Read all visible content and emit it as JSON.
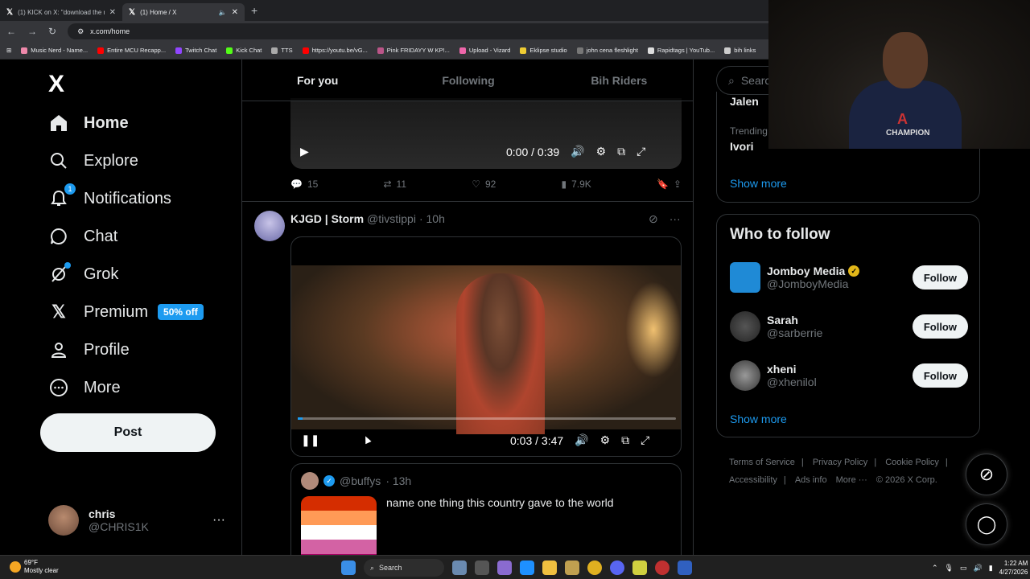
{
  "browser": {
    "tabs": [
      {
        "title": "(1) KICK on X: \"download the n",
        "active": false
      },
      {
        "title": "(1) Home / X",
        "active": true
      }
    ],
    "url": "x.com/home",
    "bookmarks": [
      "Music Nerd - Name...",
      "Entire MCU Recapp...",
      "Twitch Chat",
      "Kick Chat",
      "TTS",
      "https://youtu.be/vG...",
      "Pink FRIDAYY W KP!...",
      "Upload - Vizard",
      "Eklipse studio",
      "john cena fleshlight",
      "Rapidtags | YouTub...",
      "bih links"
    ]
  },
  "sidebar": {
    "logo": "X",
    "items": [
      {
        "label": "Home",
        "icon": "home-icon"
      },
      {
        "label": "Explore",
        "icon": "search-icon"
      },
      {
        "label": "Notifications",
        "icon": "bell-icon",
        "badge": "1"
      },
      {
        "label": "Chat",
        "icon": "chat-icon"
      },
      {
        "label": "Grok",
        "icon": "grok-icon"
      },
      {
        "label": "Premium",
        "icon": "x-icon",
        "promo": "50% off"
      },
      {
        "label": "Profile",
        "icon": "person-icon"
      },
      {
        "label": "More",
        "icon": "more-circle-icon"
      }
    ],
    "post_label": "Post",
    "account": {
      "name": "chris",
      "handle": "@CHRIS1K"
    }
  },
  "feed": {
    "tabs": [
      "For you",
      "Following",
      "Bih Riders"
    ],
    "video1": {
      "time": "0:00 / 0:39"
    },
    "video1_actions": {
      "replies": "15",
      "reposts": "11",
      "likes": "92",
      "views": "7.9K"
    },
    "tweet": {
      "name": "KJGD | Storm",
      "handle": "@tivstippi",
      "time": "· 10h",
      "video_time": "0:03 / 3:47",
      "progress": 0.013
    },
    "quote": {
      "handle": "@buffys",
      "time": "· 13h",
      "text": "name one thing this country gave to the world"
    }
  },
  "right": {
    "search_placeholder": "Searc",
    "trend_top": "Jalen",
    "trend_label": "Trending",
    "trend_name": "Ivori",
    "show_more": "Show more",
    "who_to_follow": "Who to follow",
    "suggestions": [
      {
        "name": "Jomboy Media",
        "handle": "@JomboyMedia",
        "follow": "Follow"
      },
      {
        "name": "Sarah",
        "handle": "@sarberrie",
        "follow": "Follow"
      },
      {
        "name": "xheni",
        "handle": "@xhenilol",
        "follow": "Follow"
      }
    ],
    "footer": [
      "Terms of Service",
      "Privacy Policy",
      "Cookie Policy",
      "Accessibility",
      "Ads info",
      "More ···",
      "© 2026 X Corp."
    ]
  },
  "webcam": {
    "shirt_text": "CHAMPION"
  },
  "taskbar": {
    "weather_temp": "69°F",
    "weather_desc": "Mostly clear",
    "search": "Search",
    "time": "1:22 AM",
    "date": "4/27/2026"
  },
  "colors": {
    "accent": "#1d9bf0",
    "background": "#000000",
    "border": "#2f3336"
  }
}
